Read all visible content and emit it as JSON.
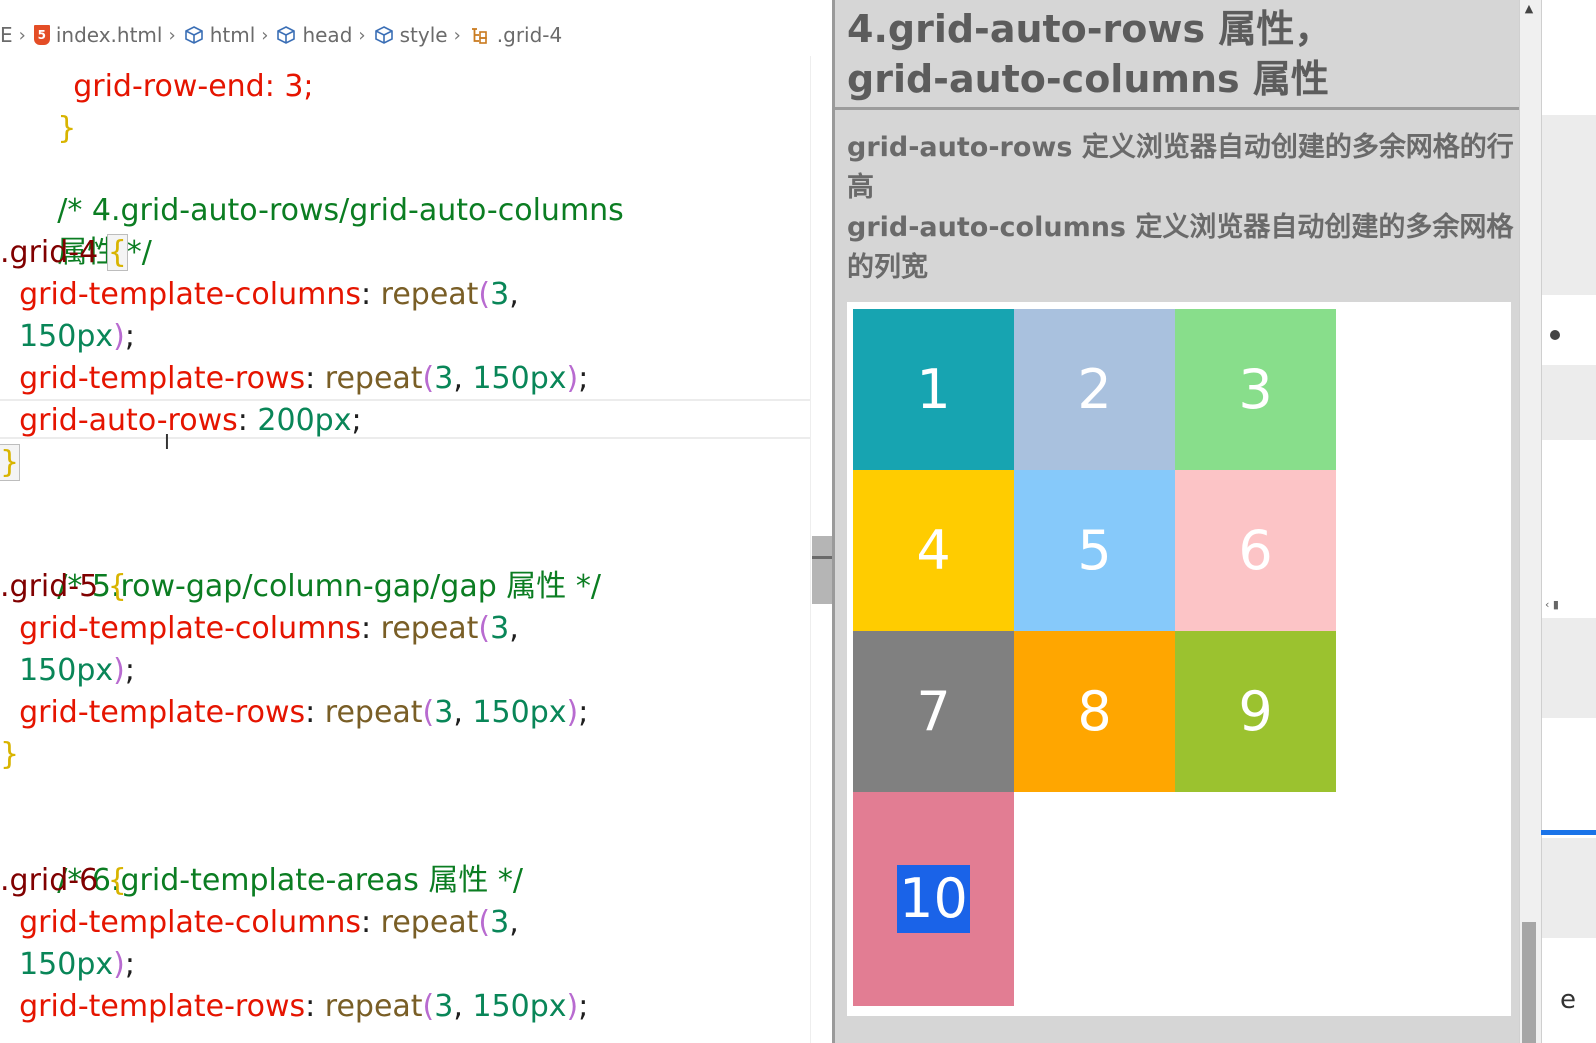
{
  "breadcrumb": {
    "lead": "E",
    "items": [
      {
        "icon": "html5-icon",
        "label": "index.html"
      },
      {
        "icon": "cube-icon",
        "label": "html"
      },
      {
        "icon": "cube-icon",
        "label": "head"
      },
      {
        "icon": "cube-icon",
        "label": "style"
      },
      {
        "icon": "selector-icon",
        "label": ".grid-4"
      }
    ]
  },
  "code": {
    "partial_top": "grid-row-end: 3;",
    "line_close_1": "}",
    "comment_4a": "/* 4.grid-auto-rows/grid-auto-columns",
    "comment_4b": "属性 */",
    "sel_4": ".grid-4",
    "open_brace": "{",
    "close_brace": "}",
    "prop_cols": "grid-template-columns",
    "prop_rows": "grid-template-rows",
    "prop_auto_rows": "grid-auto-rows",
    "fn_repeat": "repeat",
    "num_3": "3",
    "num_150px": "150px",
    "num_200px": "200px",
    "comment_5": "/* 5.row-gap/column-gap/gap 属性 */",
    "sel_5": ".grid-5",
    "comment_6": "/* 6.grid-template-areas 属性 */",
    "sel_6": ".grid-6"
  },
  "preview": {
    "heading_line1": "4.grid-auto-rows 属性，",
    "heading_line2": "grid-auto-columns 属性",
    "desc_rows": "grid-auto-rows 定义浏览器自动创建的多余网格的行高",
    "desc_cols": "grid-auto-columns 定义浏览器自动创建的多余网格的列宽",
    "cells": [
      {
        "label": "1",
        "color": "#17a4b1"
      },
      {
        "label": "2",
        "color": "#a9c1de"
      },
      {
        "label": "3",
        "color": "#88de8b"
      },
      {
        "label": "4",
        "color": "#ffcc00"
      },
      {
        "label": "5",
        "color": "#86c9fa"
      },
      {
        "label": "6",
        "color": "#fcc4c6"
      },
      {
        "label": "7",
        "color": "#808080"
      },
      {
        "label": "8",
        "color": "#ffa600"
      },
      {
        "label": "9",
        "color": "#9bc22f"
      },
      {
        "label": "10",
        "color": "#e27d93"
      }
    ]
  },
  "edge": {
    "scroll_up": "▲",
    "tail_char": "e"
  }
}
